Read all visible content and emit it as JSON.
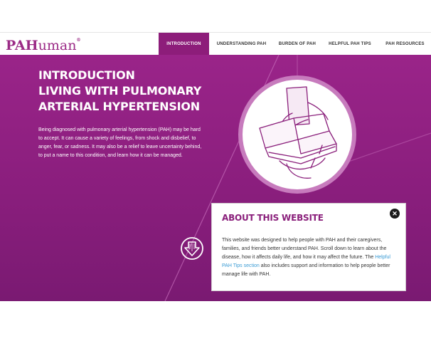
{
  "brand": {
    "logo_bold": "PAH",
    "logo_rest": "uman",
    "logo_reg": "®"
  },
  "nav": {
    "items": [
      {
        "label": "INTRODUCTION",
        "active": true
      },
      {
        "label": "UNDERSTANDING PAH",
        "active": false
      },
      {
        "label": "BURDEN OF PAH",
        "active": false
      },
      {
        "label": "HELPFUL PAH TIPS",
        "active": false
      },
      {
        "label": "PAH RESOURCES",
        "active": false
      }
    ]
  },
  "hero": {
    "title_lines": [
      "INTRODUCTION",
      "LIVING WITH PULMONARY",
      "ARTERIAL HYPERTENSION"
    ],
    "body": "Being diagnosed with pulmonary arterial hypertension (PAH) may be hard to accept. It can cause a variety of feelings, from shock and disbelief, to anger, fear, or sadness. It may also be a relief to leave uncertainty behind, to put a name to this condition, and learn how it can be managed.",
    "illustration_icon": "reading-book-icon",
    "scroll_icon": "down-arrow-icon"
  },
  "modal": {
    "title": "ABOUT THIS WEBSITE",
    "close_icon": "close-icon",
    "close_symbol": "✕",
    "text_before": "This website was designed to help people with PAH and their caregivers, families, and friends better understand PAH. Scroll down to learn about the disease, how it affects daily life, and how it may affect the future. The ",
    "link": "Helpful PAH Tips section",
    "text_after": " also includes support and information to help people better manage life with PAH."
  },
  "colors": {
    "brand": "#9b2a86",
    "hero": "#8d1f7e",
    "link": "#3a9bd4"
  }
}
